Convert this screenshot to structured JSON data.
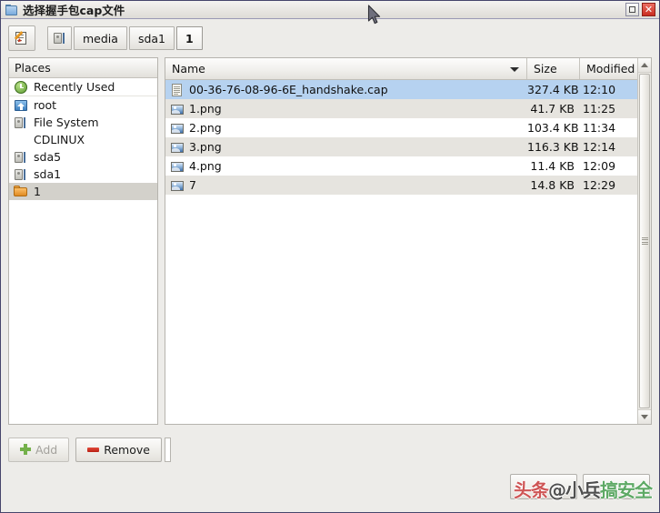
{
  "window": {
    "title": "选择握手包cap文件",
    "title_icon": "folder-icon",
    "controls": {
      "maximize_label": "",
      "close_label": "✕"
    }
  },
  "toolbar": {
    "type_path_button": {
      "icon": "type-a-file-name-icon",
      "label": ""
    },
    "breadcrumbs": [
      {
        "label": "",
        "icon": "drive-icon",
        "active": false
      },
      {
        "label": "media",
        "icon": "",
        "active": false
      },
      {
        "label": "sda1",
        "icon": "",
        "active": false
      },
      {
        "label": "1",
        "icon": "",
        "active": true
      }
    ]
  },
  "places": {
    "header": "Places",
    "header_mnemonic": "P",
    "items": [
      {
        "label": "Recently Used",
        "icon": "recent-icon",
        "selected": false,
        "indent": false
      },
      {
        "label": "root",
        "icon": "home-folder-icon",
        "selected": false,
        "indent": false
      },
      {
        "label": "File System",
        "icon": "drive-icon",
        "selected": false,
        "indent": false
      },
      {
        "label": "CDLINUX",
        "icon": "",
        "selected": false,
        "indent": true
      },
      {
        "label": "sda5",
        "icon": "drive-icon",
        "selected": false,
        "indent": false
      },
      {
        "label": "sda1",
        "icon": "drive-icon",
        "selected": false,
        "indent": false
      },
      {
        "label": "1",
        "icon": "folder-icon",
        "selected": true,
        "indent": false
      }
    ],
    "buttons": {
      "add": {
        "label": "Add",
        "mnemonic": "A",
        "icon": "plus-icon",
        "disabled": true
      },
      "remove": {
        "label": "Remove",
        "mnemonic": "R",
        "icon": "minus-icon",
        "disabled": false
      }
    }
  },
  "file_list": {
    "columns": [
      {
        "key": "name",
        "label": "Name",
        "sorted": true,
        "sort_direction": "descending"
      },
      {
        "key": "size",
        "label": "Size",
        "sorted": false
      },
      {
        "key": "modified",
        "label": "Modified",
        "sorted": false
      }
    ],
    "rows": [
      {
        "name": "00-36-76-08-96-6E_handshake.cap",
        "size": "327.4 KB",
        "modified": "12:10",
        "icon": "document-icon",
        "selected": true
      },
      {
        "name": "1.png",
        "size": "41.7 KB",
        "modified": "11:25",
        "icon": "image-icon",
        "selected": false
      },
      {
        "name": "2.png",
        "size": "103.4 KB",
        "modified": "11:34",
        "icon": "image-icon",
        "selected": false
      },
      {
        "name": "3.png",
        "size": "116.3 KB",
        "modified": "12:14",
        "icon": "image-icon",
        "selected": false
      },
      {
        "name": "4.png",
        "size": "11.4 KB",
        "modified": "12:09",
        "icon": "image-icon",
        "selected": false
      },
      {
        "name": "7",
        "size": "14.8 KB",
        "modified": "12:29",
        "icon": "image-icon",
        "selected": false
      }
    ]
  },
  "location": {
    "value": "",
    "placeholder": ""
  },
  "action_buttons": [
    {
      "name": "cancel",
      "label": ""
    },
    {
      "name": "open",
      "label": ""
    }
  ],
  "watermark": {
    "part1": "头条",
    "part2": "@小兵",
    "part3": "搞安全",
    "full": "头条@小兵搞安全"
  },
  "colors": {
    "selection_blue": "#b6d2f0",
    "selection_grey": "#d3d1cb",
    "row_alt": "#e6e4df",
    "window_bg": "#edece9",
    "title_border": "#46456b",
    "close_red": "#c92c20"
  }
}
